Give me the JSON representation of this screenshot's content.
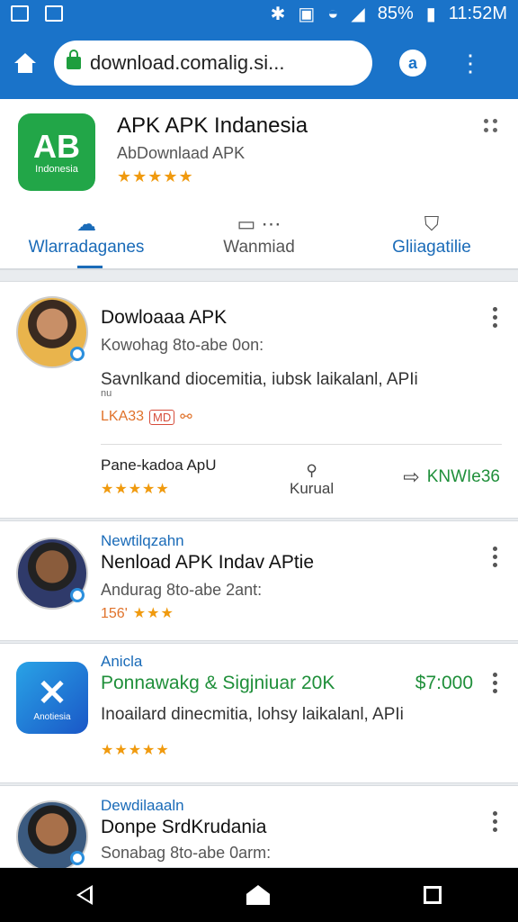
{
  "status_bar": {
    "battery_percent": "85%",
    "time": "11:52M"
  },
  "browser": {
    "url": "download.comalig.si..."
  },
  "app_header": {
    "logo_text": "AB",
    "logo_sub": "Indonesia",
    "title": "APK APK Indanesia",
    "subtitle": "AbDownlaad APK",
    "stars": "★★★★★",
    "tabs": [
      {
        "label": "Wlarradaganes",
        "icon": "cloud-icon"
      },
      {
        "label": "Wanmiad",
        "icon": "chat-icon"
      },
      {
        "label": "Gliiagatilie",
        "icon": "bookmark-icon"
      }
    ]
  },
  "cards": [
    {
      "title": "Dowloaaa APK",
      "meta": "Kowohag 8to-abe 0on:",
      "desc": "Savnlkand diocemitia, iubsk laikalanl, APIi",
      "desc_overflow": "nu",
      "badge_text": "LKA33",
      "badge_pill": "MD",
      "sub_label": "Pane-kadoa ApU",
      "sub_action": "Kurual",
      "sub_link": "KNWIe36"
    },
    {
      "category": "Newtilqzahn",
      "title": "Nenload APK Indav APtie",
      "meta": "Andurag 8to-abe 2ant:",
      "rating": "156'"
    },
    {
      "category": "Anicla",
      "title": "Ponnawakg & Sigjniuar 20K",
      "price": "$7:000",
      "desc": "Inoailard dinecmitia, lohsy laikalanl, APIi",
      "logo_sub": "Anotiesia"
    },
    {
      "category": "Dewdilaaaln",
      "title": "Donpe SrdKrudania",
      "meta": "Sonabag 8to-abe 0arm:"
    }
  ]
}
